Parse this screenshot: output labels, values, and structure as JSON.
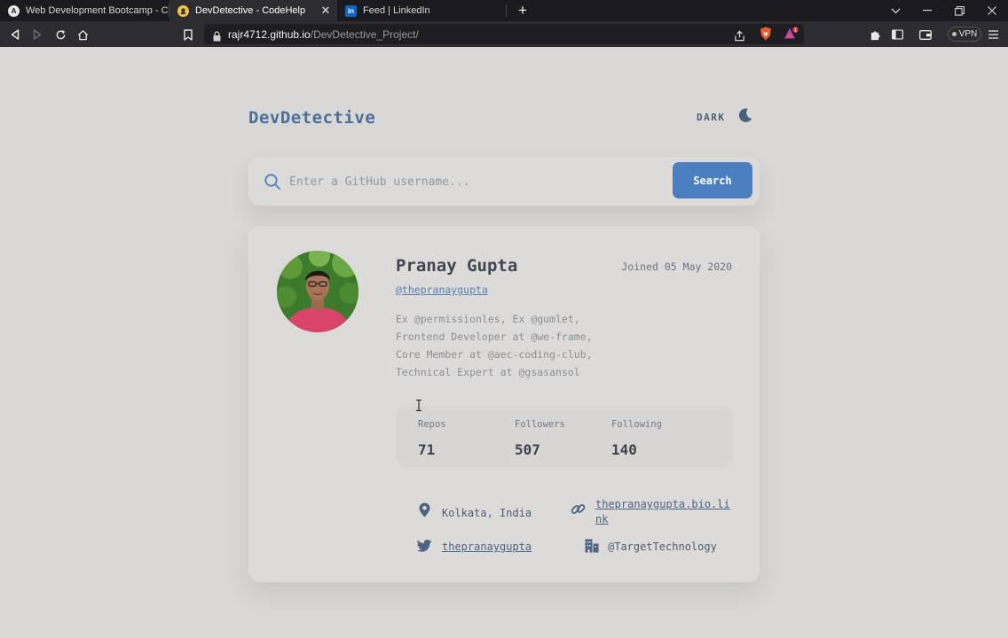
{
  "browser": {
    "tabs": [
      {
        "title": "Web Development Bootcamp - Course",
        "favicon": "A"
      },
      {
        "title": "DevDetective - CodeHelp",
        "favicon": "devdetective-icon"
      },
      {
        "title": "Feed | LinkedIn",
        "favicon": "in"
      }
    ],
    "new_tab": "+",
    "url_host": "rajr4712.github.io",
    "url_path": "/DevDetective_Project/",
    "vpn_label": "VPN",
    "colors": {
      "tabbar": "#1b1b1f",
      "toolbar": "#2c2c31",
      "brave_orange": "#f05a24"
    }
  },
  "header": {
    "logo": "DevDetective",
    "mode_label": "DARK",
    "mode_icon": "moon-icon"
  },
  "search": {
    "placeholder": "Enter a GitHub username...",
    "value": "",
    "button_label": "Search",
    "icon": "search-icon"
  },
  "profile": {
    "name": "Pranay Gupta",
    "joined": "Joined 05 May 2020",
    "handle": "@thepranaygupta",
    "bio_lines": [
      "Ex @permissionles, Ex @gumlet,",
      "Frontend Developer at @we-frame,",
      "Core Member at @aec-coding-club,",
      "Technical Expert at @gsasansol"
    ],
    "stats": [
      {
        "label": "Repos",
        "value": "71"
      },
      {
        "label": "Followers",
        "value": "507"
      },
      {
        "label": "Following",
        "value": "140"
      }
    ],
    "links": {
      "location": "Kolkata, India",
      "website": "thepranaygupta.bio.link",
      "twitter": "thepranaygupta",
      "company": "@TargetTechnology"
    }
  },
  "colors": {
    "background": "#d9d8d6",
    "card": "#dcdbd9",
    "accent": "#4c7fc0",
    "logo": "#4a6f98",
    "text_dark": "#3f4652"
  }
}
